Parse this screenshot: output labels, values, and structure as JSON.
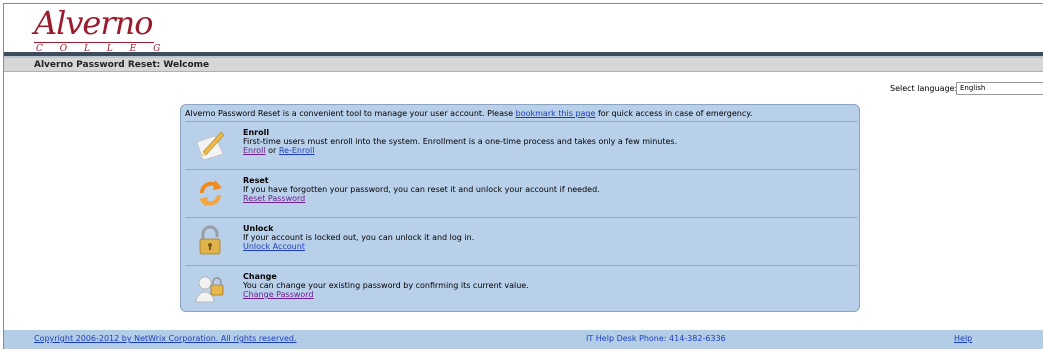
{
  "header": {
    "logo_word": "Alverno",
    "logo_college": "C O L L E G E"
  },
  "title_bar": {
    "title": "Alverno Password Reset: Welcome"
  },
  "language": {
    "label": "Select language:",
    "selected": "English"
  },
  "panel": {
    "intro_before": "Alverno Password Reset is a convenient tool to manage your user account. Please ",
    "intro_link": "bookmark this page",
    "intro_after": " for quick access in case of emergency.",
    "sections": [
      {
        "title": "Enroll",
        "description": "First-time users must enroll into the system. Enrollment is a one-time process and takes only a few minutes.",
        "link1": "Enroll",
        "joiner": " or ",
        "link2": "Re-Enroll",
        "icon": "pencil-paper-icon"
      },
      {
        "title": "Reset",
        "description": "If you have forgotten your password, you can reset it and unlock your account if needed.",
        "link1": "Reset Password",
        "icon": "refresh-arrows-icon"
      },
      {
        "title": "Unlock",
        "description": "If your account is locked out, you can unlock it and log in.",
        "link1": "Unlock Account",
        "icon": "padlock-icon"
      },
      {
        "title": "Change",
        "description": "You can change your existing password by confirming its current value.",
        "link1": "Change Password",
        "icon": "user-change-icon"
      }
    ]
  },
  "footer": {
    "copyright": "Copyright 2006-2012 by NetWrix Corporation. All rights reserved.",
    "phone": "IT Help Desk Phone: 414-382-6336",
    "help": "Help"
  },
  "colors": {
    "brand": "#9b1b2e",
    "panel_bg": "#b9d0ea",
    "footer_bg": "#b3cde7",
    "link": "#1a3dbf",
    "visited_link": "#6b1e8c"
  }
}
